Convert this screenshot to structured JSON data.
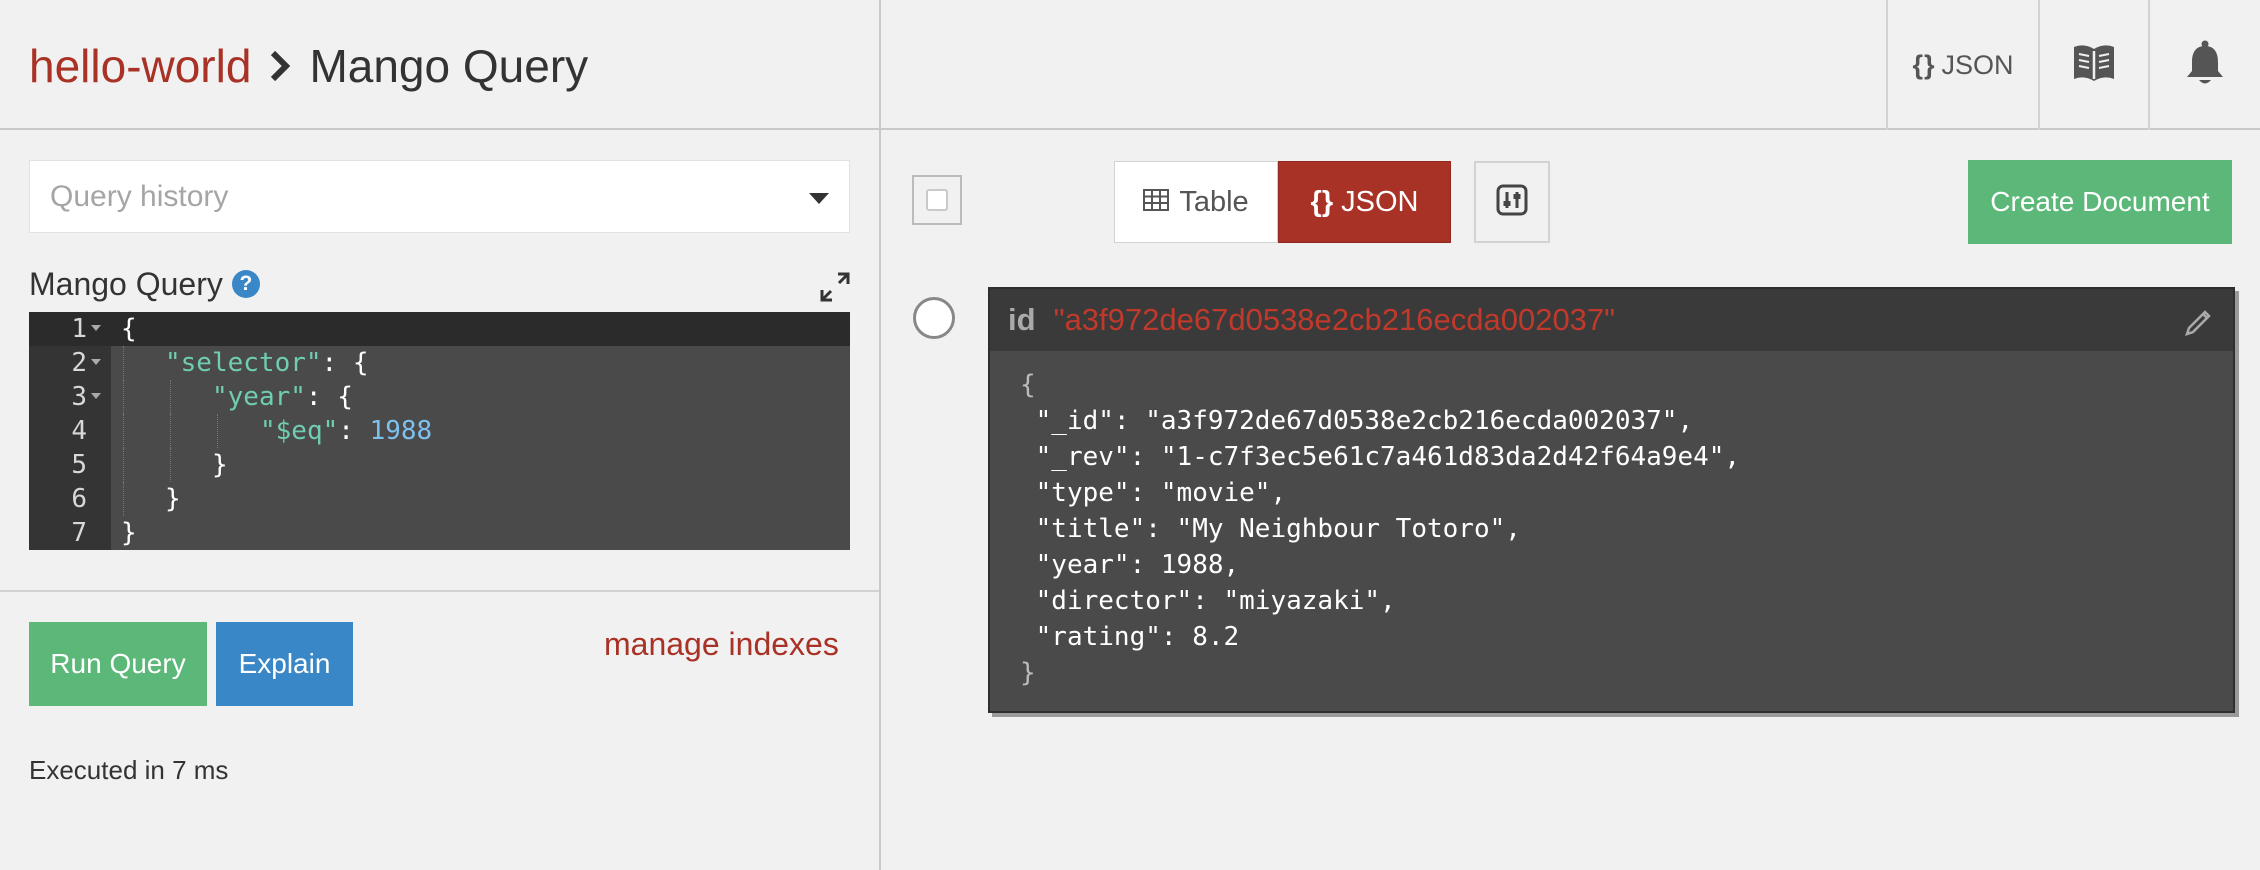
{
  "header": {
    "database": "hello-world",
    "page_title": "Mango Query",
    "json_button_braces": "{}",
    "json_button_label": "JSON",
    "docs_icon": "book-open-icon",
    "notifications_icon": "bell-icon"
  },
  "left_panel": {
    "query_history_placeholder": "Query history",
    "editor_label": "Mango Query",
    "help_glyph": "?",
    "editor_lines": [
      {
        "num": "1",
        "fold": true
      },
      {
        "num": "2",
        "fold": true
      },
      {
        "num": "3",
        "fold": true
      },
      {
        "num": "4",
        "fold": false
      },
      {
        "num": "5",
        "fold": false
      },
      {
        "num": "6",
        "fold": false
      },
      {
        "num": "7",
        "fold": false
      }
    ],
    "editor_tokens": {
      "open_brace": "{",
      "selector_key": "\"selector\"",
      "colon_brace": ": {",
      "year_key": "\"year\"",
      "eq_key": "\"$eq\"",
      "colon": ": ",
      "eq_value": "1988",
      "close_brace": "}"
    },
    "run_query_label": "Run Query",
    "explain_label": "Explain",
    "manage_indexes_label": "manage indexes",
    "execution_status": "Executed in 7 ms"
  },
  "right_panel": {
    "select_all_checked": false,
    "view_table_label": "Table",
    "view_json_braces": "{}",
    "view_json_label": "JSON",
    "active_view": "JSON",
    "columns_icon": "sliders-icon",
    "create_document_label": "Create Document",
    "document": {
      "id_label": "id",
      "id_value": "\"a3f972de67d0538e2cb216ecda002037\"",
      "open_brace": "{",
      "close_brace": "}",
      "lines": [
        "\"_id\": \"a3f972de67d0538e2cb216ecda002037\",",
        "\"_rev\": \"1-c7f3ec5e61c7a461d83da2d42f64a9e4\",",
        "\"type\": \"movie\",",
        "\"title\": \"My Neighbour Totoro\",",
        "\"year\": 1988,",
        "\"director\": \"miyazaki\",",
        "\"rating\": 8.2"
      ]
    }
  },
  "colors": {
    "brand_red": "#a93226",
    "success_green": "#5bb878",
    "primary_blue": "#3a87c8"
  }
}
